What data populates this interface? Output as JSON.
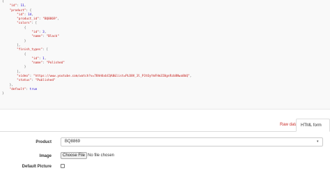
{
  "json_lines": [
    "{",
    "    \"id\": 11,",
    "    \"product\": {",
    "        \"id\": 14,",
    "        \"product_id\": \"BQ8869\",",
    "        \"colors\": [",
    "            {",
    "                \"id\": 3,",
    "                \"name\": \"Black\"",
    "            }",
    "        ],",
    "        \"finish_types\": [",
    "            {",
    "                \"id\": 1,",
    "                \"name\": \"Polished\"",
    "            }",
    "        ],",
    "        \"video\": \"https://www.youtube.com/watch?v=78hH4xbCQA8&list=PLO8V_3l_P3tOyYmFHm3I8gnRzb8Nwa8bQ\",",
    "        \"status\": \"Published\"",
    "    },",
    "    \"default\": true",
    "}"
  ],
  "tabs": {
    "raw": "Raw data",
    "html": "HTML form"
  },
  "form": {
    "product_label": "Product",
    "product_value": "BQ8869",
    "image_label": "Image",
    "choose_file": "Choose File",
    "no_file": "No file chosen",
    "default_label": "Default Picture"
  }
}
